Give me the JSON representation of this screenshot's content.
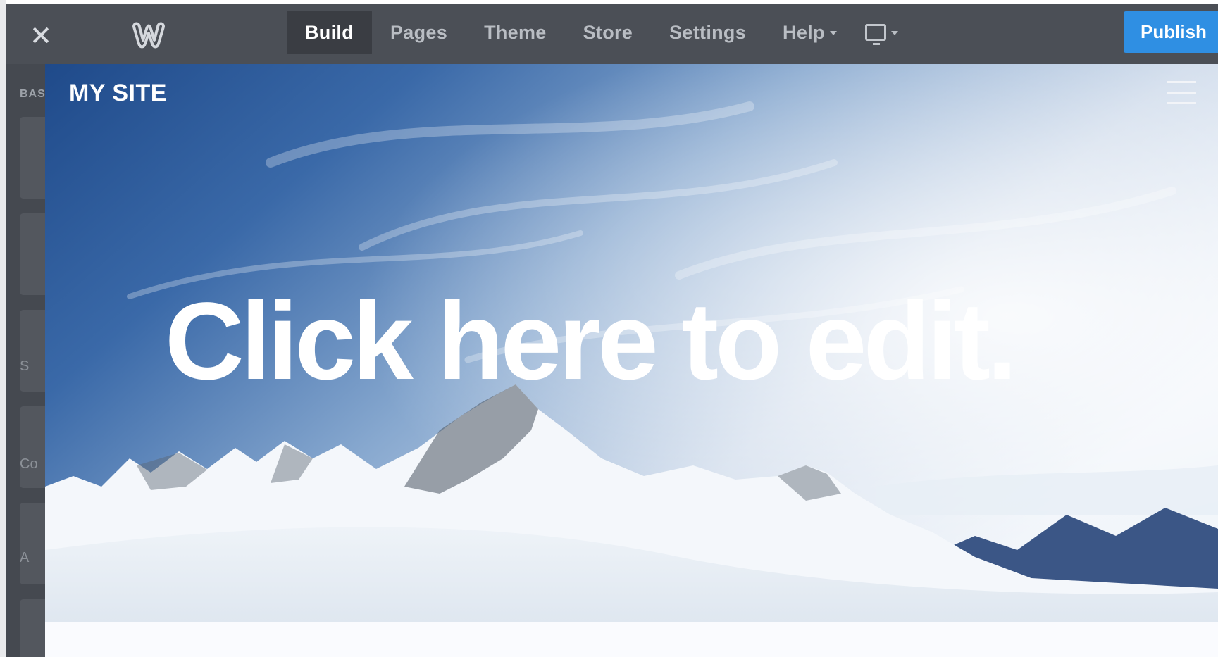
{
  "toolbar": {
    "nav": [
      {
        "label": "Build",
        "active": true
      },
      {
        "label": "Pages",
        "active": false
      },
      {
        "label": "Theme",
        "active": false
      },
      {
        "label": "Store",
        "active": false
      },
      {
        "label": "Settings",
        "active": false
      },
      {
        "label": "Help",
        "active": false
      }
    ],
    "publish_label": "Publish",
    "icons": {
      "close": "close-icon",
      "logo": "weebly-logo-icon",
      "device": "desktop-monitor-icon",
      "help_caret": "chevron-down-icon"
    },
    "colors": {
      "bar": "#4b4f56",
      "active_tab": "#3a3d43",
      "publish": "#2f8fe3"
    }
  },
  "side_panel": {
    "label": "BAS",
    "tile_labels": [
      "S",
      "Co",
      "A"
    ]
  },
  "canvas": {
    "site_title": "MY SITE",
    "headline": "Click here to edit.",
    "menu_icon": "hamburger-menu-icon"
  }
}
